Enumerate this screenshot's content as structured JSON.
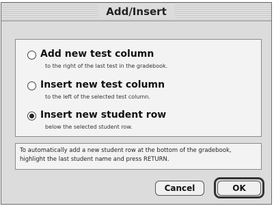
{
  "dialog": {
    "title": "Add/Insert",
    "options": [
      {
        "label": "Add new test column",
        "description": "to the right of the last test in the gradebook.",
        "selected": false
      },
      {
        "label": "Insert new test column",
        "description": "to the left of the selected test column.",
        "selected": false
      },
      {
        "label": "Insert new student row",
        "description": "below the selected student row.",
        "selected": true
      }
    ],
    "note": "To automatically add a new student row at the bottom of the gradebook, highlight the last student name and press RETURN.",
    "buttons": {
      "cancel": "Cancel",
      "ok": "OK"
    }
  }
}
